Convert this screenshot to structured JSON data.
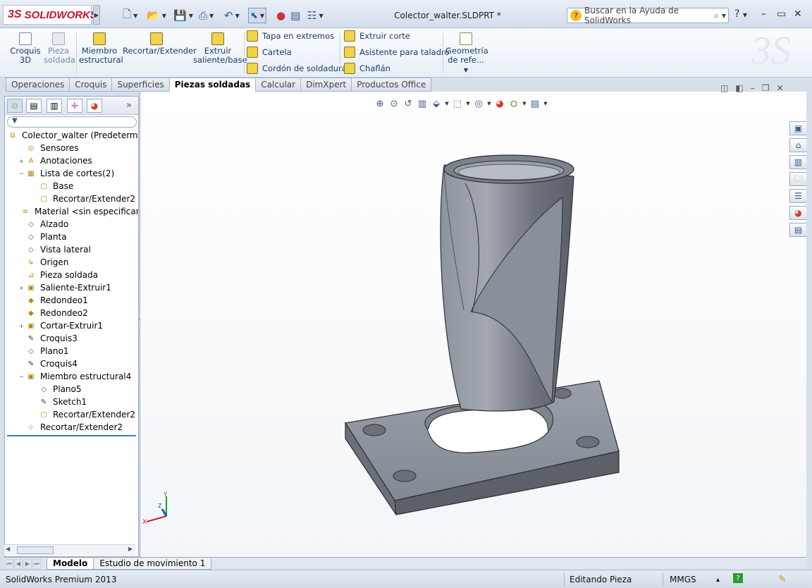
{
  "app": {
    "brand": "SOLIDWORKS",
    "document_title": "Colector_walter.SLDPRT *",
    "search_placeholder": "Buscar en la Ayuda de SolidWorks"
  },
  "ribbon": {
    "big_buttons": [
      {
        "label1": "Croquis",
        "label2": "3D"
      },
      {
        "label1": "Pieza",
        "label2": "soldada"
      },
      {
        "label1": "Miembro",
        "label2": "estructural"
      },
      {
        "label1": "Recortar/Extender",
        "label2": ""
      },
      {
        "label1": "Extruir",
        "label2": "saliente/base"
      }
    ],
    "col1": [
      "Tapa en extremos",
      "Cartela",
      "Cordón de soldadura"
    ],
    "col2": [
      "Extruir corte",
      "Asistente para taladro",
      "Chaflán"
    ],
    "ref_geometry": {
      "label1": "Geometría",
      "label2": "de refe..."
    }
  },
  "tabs": [
    "Operaciones",
    "Croquis",
    "Superficies",
    "Piezas soldadas",
    "Calcular",
    "DimXpert",
    "Productos Office"
  ],
  "active_tab": "Piezas soldadas",
  "tree": [
    {
      "label": "Colector_walter  (Predeterminado",
      "indent": 0,
      "icon": "part-icon",
      "glyph": "⧉",
      "exp": ""
    },
    {
      "label": "Sensores",
      "indent": 1,
      "icon": "sensors-icon",
      "glyph": "◎",
      "exp": ""
    },
    {
      "label": "Anotaciones",
      "indent": 1,
      "icon": "annotations-icon",
      "glyph": "A",
      "exp": "+"
    },
    {
      "label": "Lista de cortes(2)",
      "indent": 1,
      "icon": "cut-list-icon",
      "glyph": "▦",
      "exp": "−"
    },
    {
      "label": "Base",
      "indent": 2,
      "icon": "cut-item-icon",
      "glyph": "▢",
      "exp": ""
    },
    {
      "label": "Recortar/Extender2",
      "indent": 2,
      "icon": "cut-item-icon",
      "glyph": "▢",
      "exp": ""
    },
    {
      "label": "Material <sin especificar>",
      "indent": 1,
      "icon": "material-icon",
      "glyph": "≡",
      "exp": ""
    },
    {
      "label": "Alzado",
      "indent": 1,
      "icon": "plane-icon",
      "glyph": "◇",
      "exp": ""
    },
    {
      "label": "Planta",
      "indent": 1,
      "icon": "plane-icon",
      "glyph": "◇",
      "exp": ""
    },
    {
      "label": "Vista lateral",
      "indent": 1,
      "icon": "plane-icon",
      "glyph": "◇",
      "exp": ""
    },
    {
      "label": "Origen",
      "indent": 1,
      "icon": "origin-icon",
      "glyph": "↳",
      "exp": ""
    },
    {
      "label": "Pieza soldada",
      "indent": 1,
      "icon": "weldment-icon",
      "glyph": "⊿",
      "exp": ""
    },
    {
      "label": "Saliente-Extruir1",
      "indent": 1,
      "icon": "extrude-icon",
      "glyph": "▣",
      "exp": "+"
    },
    {
      "label": "Redondeo1",
      "indent": 1,
      "icon": "fillet-icon",
      "glyph": "◆",
      "exp": ""
    },
    {
      "label": "Redondeo2",
      "indent": 1,
      "icon": "fillet-icon",
      "glyph": "◆",
      "exp": ""
    },
    {
      "label": "Cortar-Extruir1",
      "indent": 1,
      "icon": "cut-extrude-icon",
      "glyph": "▣",
      "exp": "+"
    },
    {
      "label": "Croquis3",
      "indent": 1,
      "icon": "sketch-icon",
      "glyph": "✎",
      "exp": ""
    },
    {
      "label": "Plano1",
      "indent": 1,
      "icon": "plane-icon",
      "glyph": "◇",
      "exp": ""
    },
    {
      "label": "Croquis4",
      "indent": 1,
      "icon": "sketch-icon",
      "glyph": "✎",
      "exp": ""
    },
    {
      "label": "Miembro estructural4",
      "indent": 1,
      "icon": "structural-member-icon",
      "glyph": "▣",
      "exp": "−"
    },
    {
      "label": "Plano5",
      "indent": 2,
      "icon": "plane-icon",
      "glyph": "◇",
      "exp": ""
    },
    {
      "label": "Sketch1",
      "indent": 2,
      "icon": "sketch-icon",
      "glyph": "✎",
      "exp": ""
    },
    {
      "label": "Recortar/Extender2",
      "indent": 2,
      "icon": "cut-item-icon",
      "glyph": "▢",
      "exp": ""
    },
    {
      "label": "Recortar/Extender2",
      "indent": 1,
      "icon": "trim-extend-icon",
      "glyph": "⊹",
      "exp": ""
    }
  ],
  "triad": {
    "x": "X",
    "y": "Y",
    "z": "Z"
  },
  "bottom_tabs": [
    "Modelo",
    "Estudio de movimiento 1"
  ],
  "status": {
    "product": "SolidWorks Premium 2013",
    "mode": "Editando Pieza",
    "units": "MMGS",
    "units_arrow": "▴",
    "help": "?"
  },
  "colors": {
    "model_fill": "#8d939e",
    "model_dark": "#5c616b",
    "model_light": "#b7bcc5",
    "brand_red": "#c8102e"
  }
}
